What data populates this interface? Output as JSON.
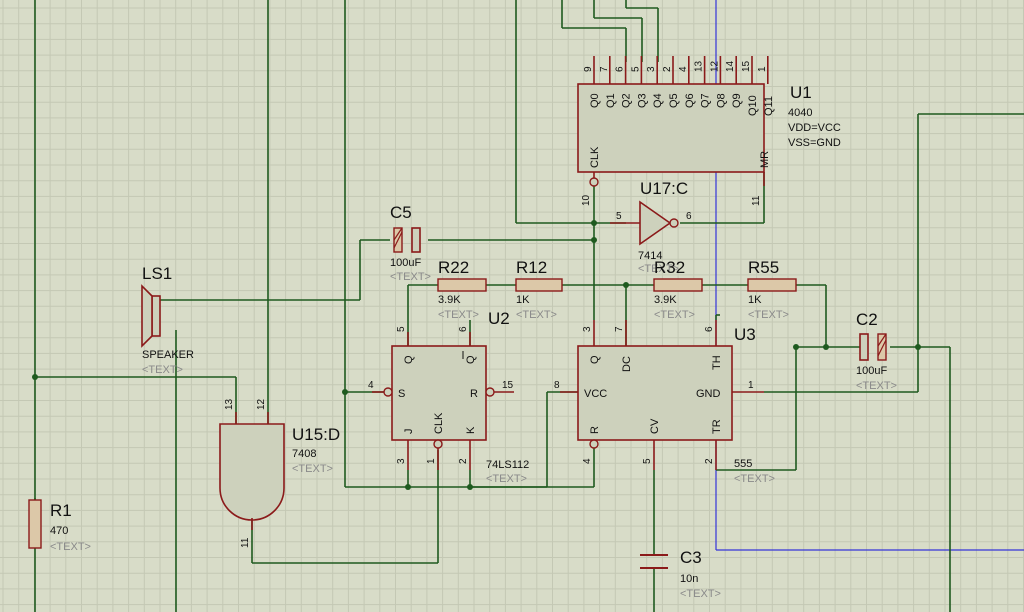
{
  "components": {
    "U1": {
      "ref": "U1",
      "value": "4040",
      "props": [
        "VDD=VCC",
        "VSS=GND"
      ],
      "top_pins": [
        "9",
        "7",
        "6",
        "5",
        "3",
        "2",
        "4",
        "13",
        "12",
        "14",
        "15",
        "1"
      ],
      "top_labels": [
        "Q0",
        "Q1",
        "Q2",
        "Q3",
        "Q4",
        "Q5",
        "Q6",
        "Q7",
        "Q8",
        "Q9",
        "Q10",
        "Q11"
      ],
      "clk_label": "CLK",
      "clk_pin": "10",
      "mr_label": "MR",
      "mr_pin": "11"
    },
    "U17C": {
      "ref": "U17:C",
      "value": "7414",
      "in_pin": "5",
      "out_pin": "6",
      "text": "<TEXT>"
    },
    "C5": {
      "ref": "C5",
      "value": "100uF",
      "text": "<TEXT>"
    },
    "LS1": {
      "ref": "LS1",
      "value": "SPEAKER",
      "text": "<TEXT>"
    },
    "R22": {
      "ref": "R22",
      "value": "3.9K",
      "text": "<TEXT>"
    },
    "R12": {
      "ref": "R12",
      "value": "1K",
      "text": "<TEXT>"
    },
    "R32": {
      "ref": "R32",
      "value": "3.9K",
      "text": "<TEXT>"
    },
    "R55": {
      "ref": "R55",
      "value": "1K",
      "text": "<TEXT>"
    },
    "C2": {
      "ref": "C2",
      "value": "100uF",
      "text": "<TEXT>"
    },
    "U2": {
      "ref": "U2",
      "value": "74LS112",
      "text": "<TEXT>",
      "labels": {
        "Q": "Q",
        "QB": "Q",
        "S": "S",
        "R": "R",
        "J": "J",
        "CLK": "CLK",
        "K": "K"
      },
      "pins": {
        "q": "5",
        "qb": "6",
        "s": "4",
        "r": "15",
        "j": "3",
        "clk": "1",
        "k": "2"
      }
    },
    "U3": {
      "ref": "U3",
      "value": "555",
      "text": "<TEXT>",
      "labels": {
        "Q": "Q",
        "DC": "DC",
        "VCC": "VCC",
        "R": "R",
        "CV": "CV",
        "TR": "TR",
        "TH": "TH",
        "GND": "GND"
      },
      "pins": {
        "q": "3",
        "dc": "7",
        "th": "6",
        "vcc": "8",
        "gnd": "1",
        "r": "4",
        "cv": "5",
        "tr": "2"
      }
    },
    "U15D": {
      "ref": "U15:D",
      "value": "7408",
      "text": "<TEXT>",
      "pin_a": "13",
      "pin_b": "12",
      "pin_y": "11"
    },
    "R1": {
      "ref": "R1",
      "value": "470",
      "text": "<TEXT>"
    },
    "C3": {
      "ref": "C3",
      "value": "10n",
      "text": "<TEXT>"
    }
  },
  "colors": {
    "background": "#d8dcc8",
    "wire": "#1f5a1f",
    "component": "#8b1a1a",
    "bus": "#3434d8"
  }
}
